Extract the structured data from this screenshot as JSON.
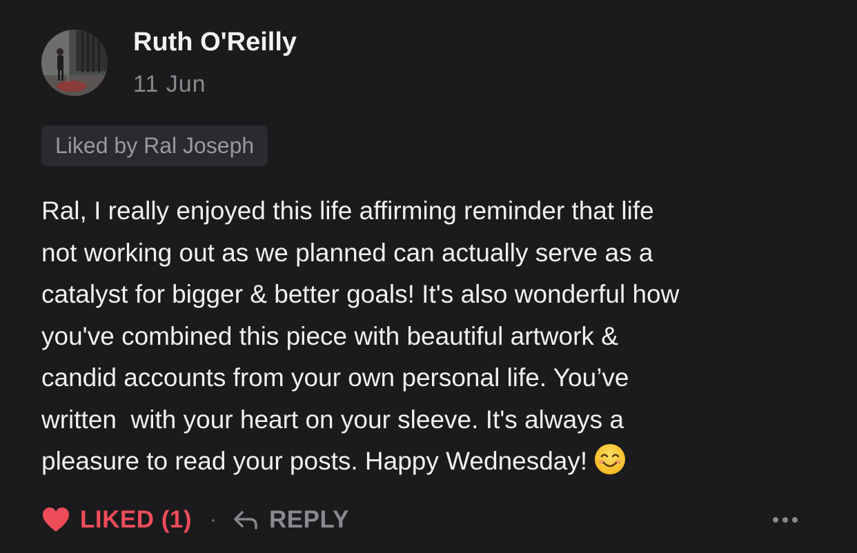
{
  "comment": {
    "author": "Ruth O'Reilly",
    "date": "11  Jun",
    "liked_by": "Liked by Ral Joseph",
    "lines": [
      "Ral, I really enjoyed this life affirming reminder that life",
      "not working out as we planned can actually serve as a",
      "catalyst for bigger & better goals! It's also wonderful how",
      "you've combined this piece with beautiful artwork &",
      "candid accounts from your own personal life. You’ve",
      "written  with your heart on your sleeve. It's always a",
      "pleasure to read your posts. Happy Wednesday!"
    ],
    "emoji": "smiling-face-emoji"
  },
  "actions": {
    "like_label": "LIKED (1)",
    "separator": "·",
    "reply_label": "REPLY"
  },
  "icons": {
    "heart": "heart-icon",
    "reply": "reply-arrow-icon",
    "more": "more-dots-icon"
  },
  "colors": {
    "background": "#1b1a1d",
    "liked_accent": "#ef4c5a",
    "muted_text": "#8a8a8e"
  }
}
